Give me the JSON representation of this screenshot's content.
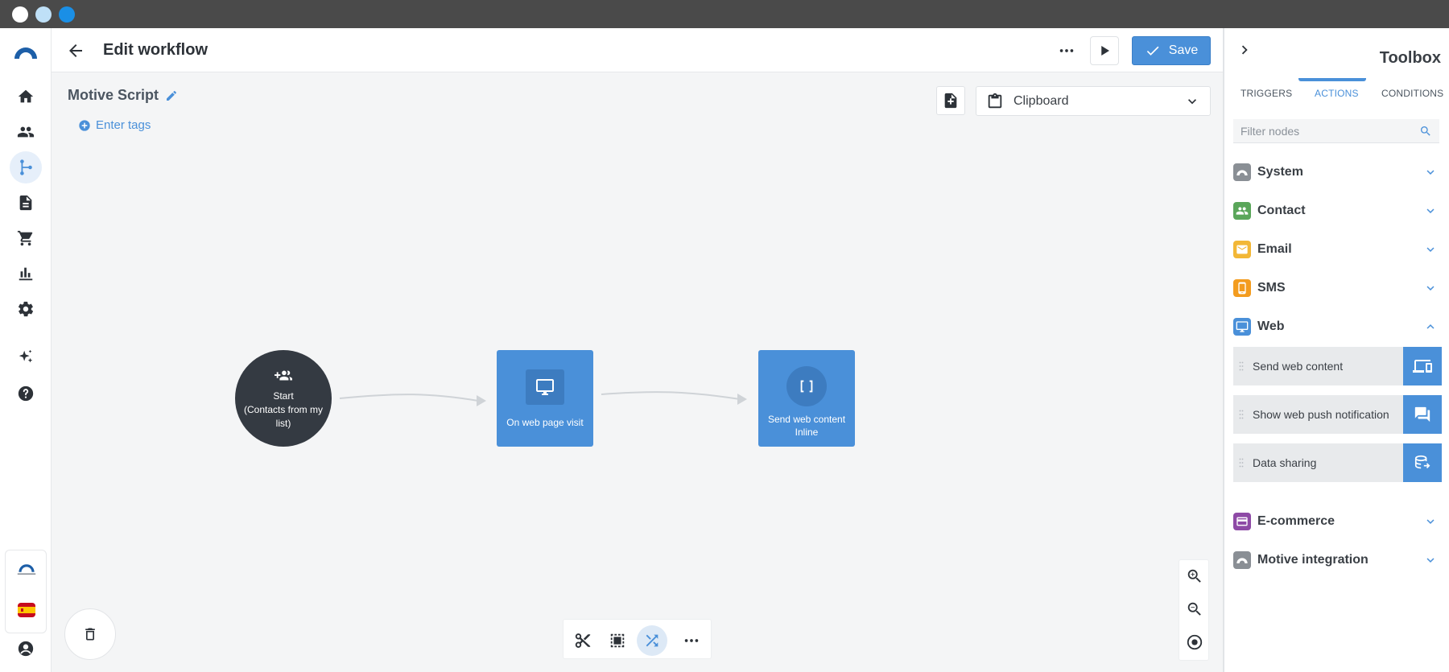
{
  "header": {
    "title": "Edit workflow",
    "save_label": "Save"
  },
  "workflow": {
    "name": "Motive Script",
    "tags_placeholder": "Enter tags",
    "clipboard_label": "Clipboard"
  },
  "nodes": {
    "start": {
      "line1": "Start",
      "line2": "(Contacts from my list)"
    },
    "web_visit": {
      "label": "On web page visit"
    },
    "send_web": {
      "line1": "Send web content",
      "line2": "Inline"
    }
  },
  "toolbox": {
    "title": "Toolbox",
    "tabs": [
      {
        "label": "TRIGGERS"
      },
      {
        "label": "ACTIONS"
      },
      {
        "label": "CONDITIONS"
      }
    ],
    "active_tab": "ACTIONS",
    "filter_placeholder": "Filter nodes",
    "categories": [
      {
        "label": "System",
        "color": "#8a8f95",
        "expanded": false
      },
      {
        "label": "Contact",
        "color": "#5aa65a",
        "expanded": false
      },
      {
        "label": "Email",
        "color": "#f2b736",
        "expanded": false
      },
      {
        "label": "SMS",
        "color": "#f39c1f",
        "expanded": false
      },
      {
        "label": "Web",
        "color": "#4a90d9",
        "expanded": true
      },
      {
        "label": "E-commerce",
        "color": "#8e4aa6",
        "expanded": false
      },
      {
        "label": "Motive integration",
        "color": "#8a8f95",
        "expanded": false
      }
    ],
    "web_actions": [
      {
        "label": "Send web content",
        "icon": "devices-icon"
      },
      {
        "label": "Show web push notification",
        "icon": "chat-icon"
      },
      {
        "label": "Data sharing",
        "icon": "data-share-icon"
      }
    ]
  },
  "colors": {
    "accent": "#4a90d9",
    "node_dark": "#343a42",
    "canvas_bg": "#f4f5f6"
  }
}
